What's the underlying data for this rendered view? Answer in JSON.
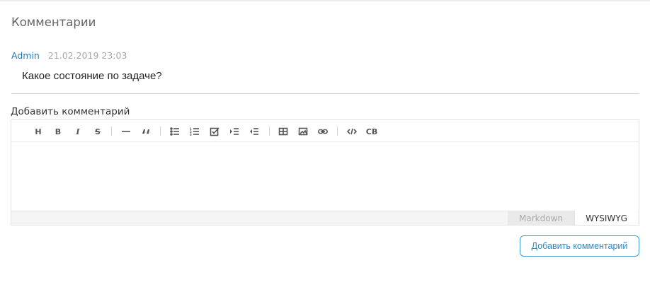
{
  "comments": {
    "title": "Комментарии",
    "items": [
      {
        "author": "Admin",
        "date": "21.02.2019 23:03",
        "text": "Какое состояние по задаче?"
      }
    ]
  },
  "form": {
    "label": "Добавить комментарий",
    "submit_label": "Добавить комментарий"
  },
  "toolbar": {
    "heading": "H",
    "bold": "B",
    "italic": "I",
    "strike": "S",
    "codeblock": "CB",
    "icons": [
      "heading-icon",
      "bold-icon",
      "italic-icon",
      "strike-icon",
      "hr-icon",
      "quote-icon",
      "bullet-list-icon",
      "ordered-list-icon",
      "task-list-icon",
      "indent-icon",
      "outdent-icon",
      "table-icon",
      "image-icon",
      "link-icon",
      "code-icon",
      "codeblock-icon"
    ]
  },
  "editor": {
    "mode_markdown": "Markdown",
    "mode_wysiwyg": "WYSIWYG",
    "active_mode": "WYSIWYG"
  },
  "colors": {
    "link": "#1f79b7",
    "accent": "#3f9cd6"
  }
}
